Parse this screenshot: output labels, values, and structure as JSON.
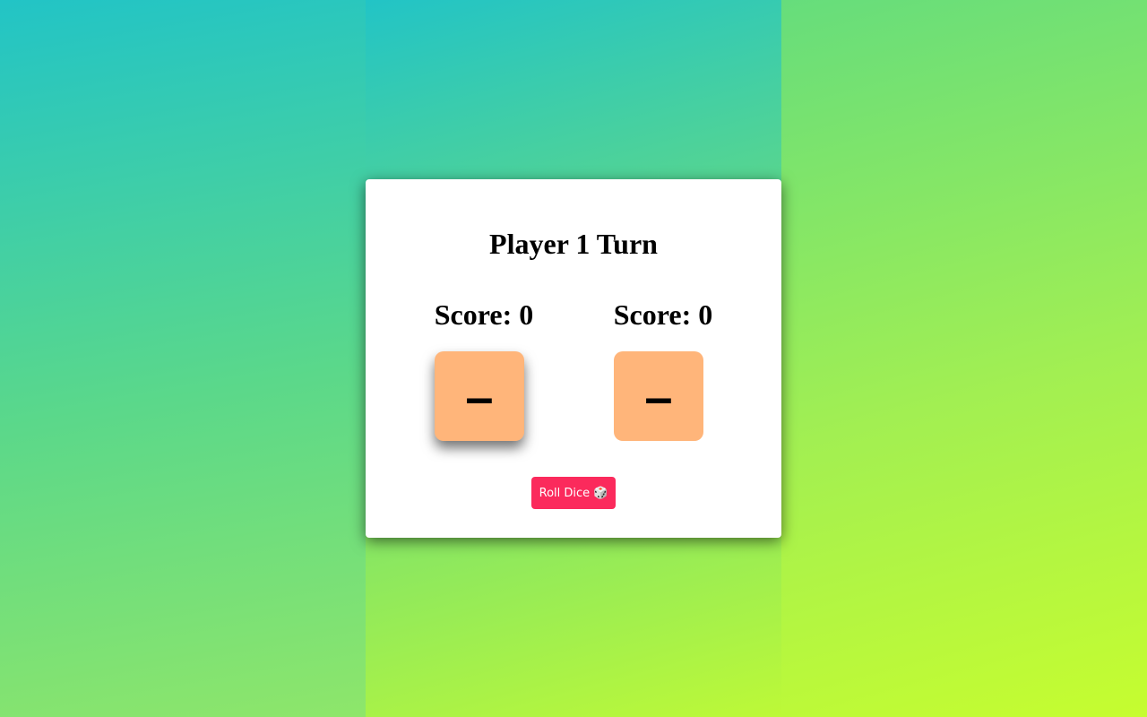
{
  "game": {
    "turn_text": "Player 1 Turn",
    "roll_label": "Roll Dice",
    "roll_icon": "🎲",
    "accent_color": "#fb2a5c",
    "die_color": "#ffb57a"
  },
  "players": [
    {
      "score_text": "Score: 0",
      "die_value": "–",
      "active": true
    },
    {
      "score_text": "Score: 0",
      "die_value": "–",
      "active": false
    }
  ]
}
